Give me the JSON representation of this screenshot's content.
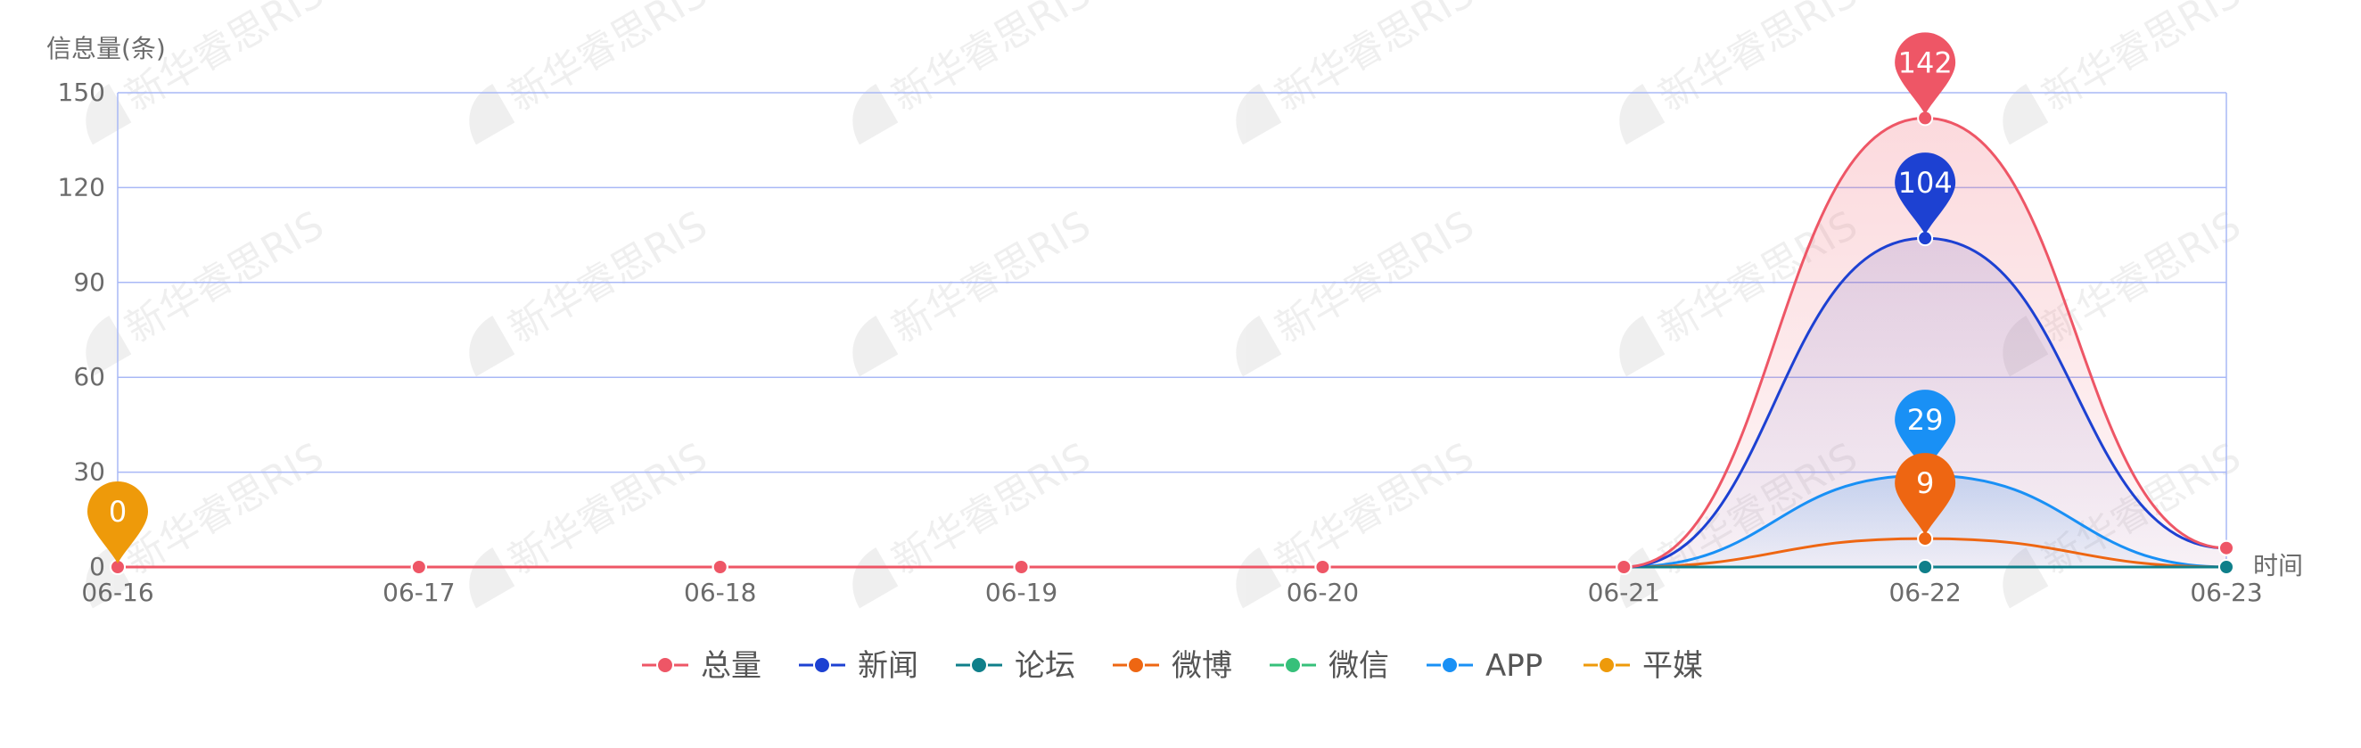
{
  "chart_data": {
    "type": "line",
    "ylabel": "信息量(条)",
    "xlabel": "时间",
    "categories": [
      "06-16",
      "06-17",
      "06-18",
      "06-19",
      "06-20",
      "06-21",
      "06-22",
      "06-23"
    ],
    "ylim": [
      0,
      150
    ],
    "yticks": [
      0,
      30,
      60,
      90,
      120,
      150
    ],
    "grid": true,
    "smooth": true,
    "legend_position": "bottom",
    "series": [
      {
        "name": "总量",
        "color": "#ee5666",
        "values": [
          0,
          0,
          0,
          0,
          0,
          0,
          142,
          6
        ],
        "area": true
      },
      {
        "name": "新闻",
        "color": "#1d41d2",
        "values": [
          0,
          0,
          0,
          0,
          0,
          0,
          104,
          6
        ],
        "area": true
      },
      {
        "name": "论坛",
        "color": "#0f7f8a",
        "values": [
          0,
          0,
          0,
          0,
          0,
          0,
          0,
          0
        ],
        "area": false
      },
      {
        "name": "微博",
        "color": "#ee6612",
        "values": [
          0,
          0,
          0,
          0,
          0,
          0,
          9,
          0
        ],
        "area": false
      },
      {
        "name": "微信",
        "color": "#36c07a",
        "values": [
          0,
          0,
          0,
          0,
          0,
          0,
          0,
          0
        ],
        "area": false
      },
      {
        "name": "APP",
        "color": "#1990f5",
        "values": [
          0,
          0,
          0,
          0,
          0,
          0,
          29,
          0
        ],
        "area": true
      },
      {
        "name": "平媒",
        "color": "#ee9a0a",
        "values": [
          0,
          0,
          0,
          0,
          0,
          0,
          0,
          0
        ],
        "area": false
      }
    ],
    "markers": [
      {
        "series": "总量",
        "x": "06-22",
        "value": 142,
        "label": "142"
      },
      {
        "series": "新闻",
        "x": "06-22",
        "value": 104,
        "label": "104"
      },
      {
        "series": "APP",
        "x": "06-22",
        "value": 29,
        "label": "29"
      },
      {
        "series": "微博",
        "x": "06-22",
        "value": 9,
        "label": "9"
      },
      {
        "series": "平媒",
        "x": "06-16",
        "value": 0,
        "label": "0"
      }
    ]
  },
  "watermark": {
    "text": "新华睿思RIS"
  }
}
